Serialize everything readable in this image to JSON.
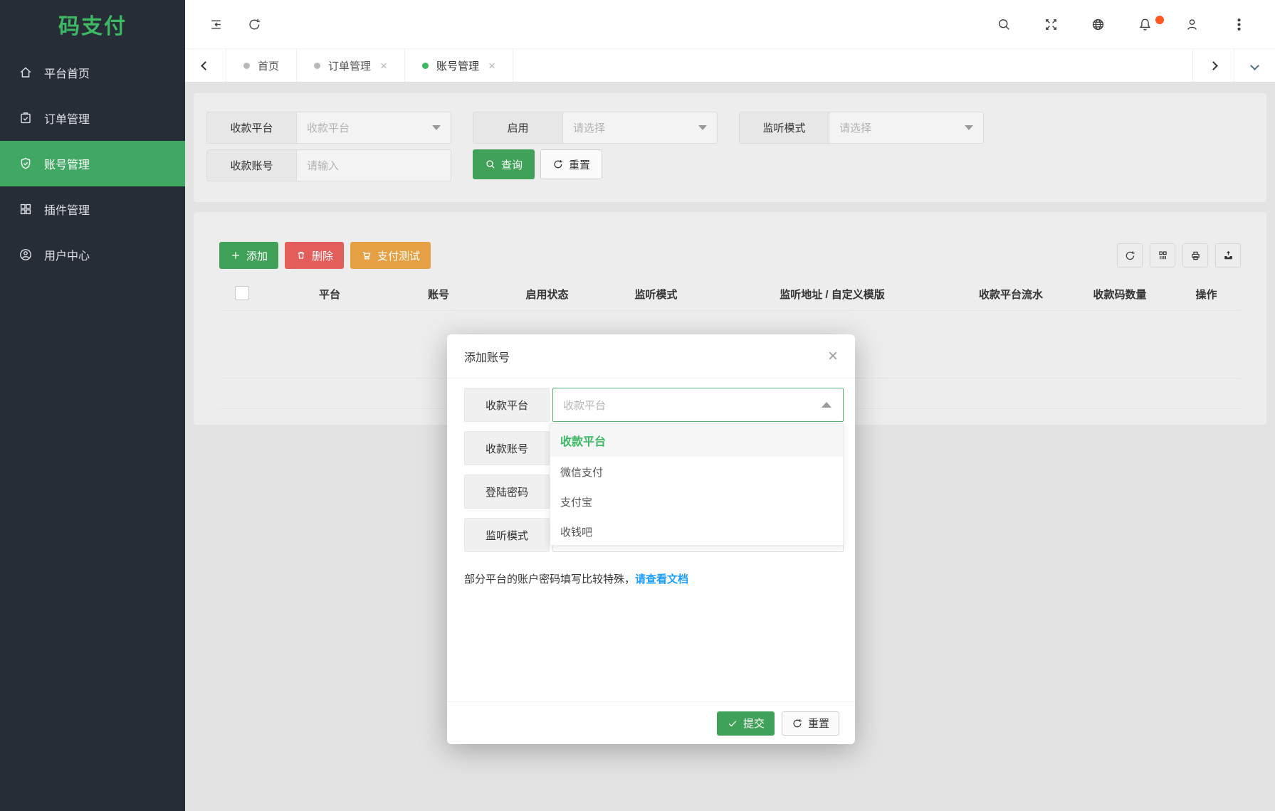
{
  "brand": {
    "logo_text": "码支付"
  },
  "sidebar": {
    "items": [
      {
        "label": "平台首页",
        "icon": "home-icon",
        "active": false
      },
      {
        "label": "订单管理",
        "icon": "order-icon",
        "active": false
      },
      {
        "label": "账号管理",
        "icon": "shield-check-icon",
        "active": true
      },
      {
        "label": "插件管理",
        "icon": "plugin-icon",
        "active": false
      },
      {
        "label": "用户中心",
        "icon": "user-center-icon",
        "active": false
      }
    ]
  },
  "tabbar": {
    "tabs": [
      {
        "label": "首页",
        "closable": false,
        "active": false
      },
      {
        "label": "订单管理",
        "closable": true,
        "active": false
      },
      {
        "label": "账号管理",
        "closable": true,
        "active": true
      }
    ],
    "close_glyph": "×"
  },
  "filter": {
    "platform_label": "收款平台",
    "platform_placeholder": "收款平台",
    "enable_label": "启用",
    "enable_placeholder": "请选择",
    "listen_label": "监听模式",
    "listen_placeholder": "请选择",
    "account_label": "收款账号",
    "account_placeholder": "请输入",
    "search_button": "查询",
    "reset_button": "重置"
  },
  "toolbar": {
    "add_button": "添加",
    "delete_button": "删除",
    "paytest_button": "支付测试"
  },
  "table": {
    "columns": [
      "平台",
      "账号",
      "启用状态",
      "监听模式",
      "监听地址 / 自定义模版",
      "收款平台流水",
      "收款码数量",
      "操作"
    ]
  },
  "modal": {
    "title": "添加账号",
    "close_glyph": "×",
    "platform_label": "收款平台",
    "platform_placeholder": "收款平台",
    "account_label": "收款账号",
    "password_label": "登陆密码",
    "listen_label": "监听模式",
    "dropdown_options": [
      "收款平台",
      "微信支付",
      "支付宝",
      "收钱吧"
    ],
    "hint_text": "部分平台的账户密码填写比较特殊，",
    "hint_link": "请查看文档",
    "submit_button": "提交",
    "reset_button": "重置"
  },
  "colors": {
    "brand_green": "#3db863",
    "active_green": "#41a863",
    "button_green": "#40a158",
    "danger_red": "#e35d5b",
    "warning_orange": "#e4a042",
    "link_blue": "#1e9fff",
    "notify_dot": "#ff5722",
    "sidebar_bg": "#262d36"
  }
}
